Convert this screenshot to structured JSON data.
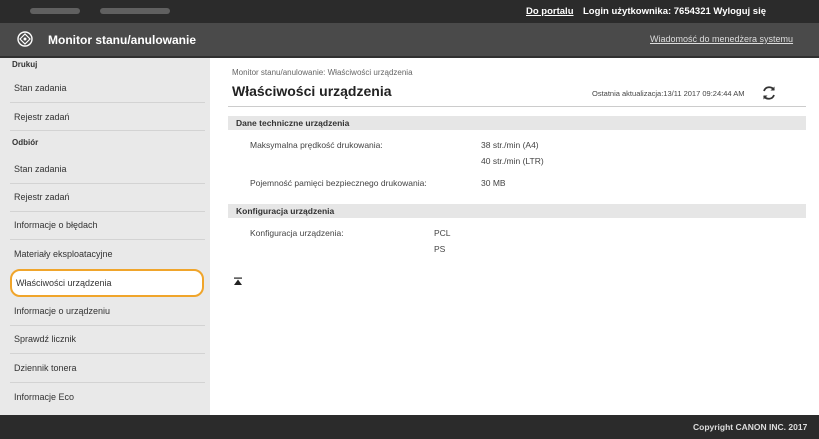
{
  "topbar": {
    "portal_link": "Do portalu",
    "login_text": "Login użytkownika:  7654321  Wyloguj się"
  },
  "header": {
    "app_title": "Monitor stanu/anulowanie",
    "message_link": "Wiadomość do menedżera systemu"
  },
  "sidebar": {
    "section_print": "Drukuj",
    "print_items": [
      "Stan zadania",
      "Rejestr zadań"
    ],
    "section_receive": "Odbiór",
    "receive_items": [
      "Stan zadania",
      "Rejestr zadań"
    ],
    "other_items": [
      "Informacje o błędach",
      "Materiały eksploatacyjne",
      "Właściwości urządzenia",
      "Informacje o urządzeniu",
      "Sprawdź licznik",
      "Dziennik tonera",
      "Informacje Eco"
    ],
    "active_item": "Właściwości urządzenia"
  },
  "main": {
    "breadcrumb": "Monitor stanu/anulowanie: Właściwości urządzenia",
    "title": "Właściwości urządzenia",
    "last_update": "Ostatnia aktualizacja:13/11 2017 09:24:44 AM",
    "section_specs": "Dane techniczne urządzenia",
    "max_speed_label": "Maksymalna prędkość drukowania:",
    "max_speed_a4": "38 str./min (A4)",
    "max_speed_ltr": "40 str./min (LTR)",
    "secure_mem_label": "Pojemność pamięci bezpiecznego drukowania:",
    "secure_mem_value": "30 MB",
    "section_config": "Konfiguracja urządzenia",
    "config_label": "Konfiguracja urządzenia:",
    "config_values": [
      "PCL",
      "PS"
    ]
  },
  "footer": {
    "copyright": "Copyright CANON INC. 2017"
  },
  "colors": {
    "highlight": "#f0a52b",
    "dark_bar": "#2b2b2b",
    "sidebar_bg": "#e9e9e9"
  }
}
